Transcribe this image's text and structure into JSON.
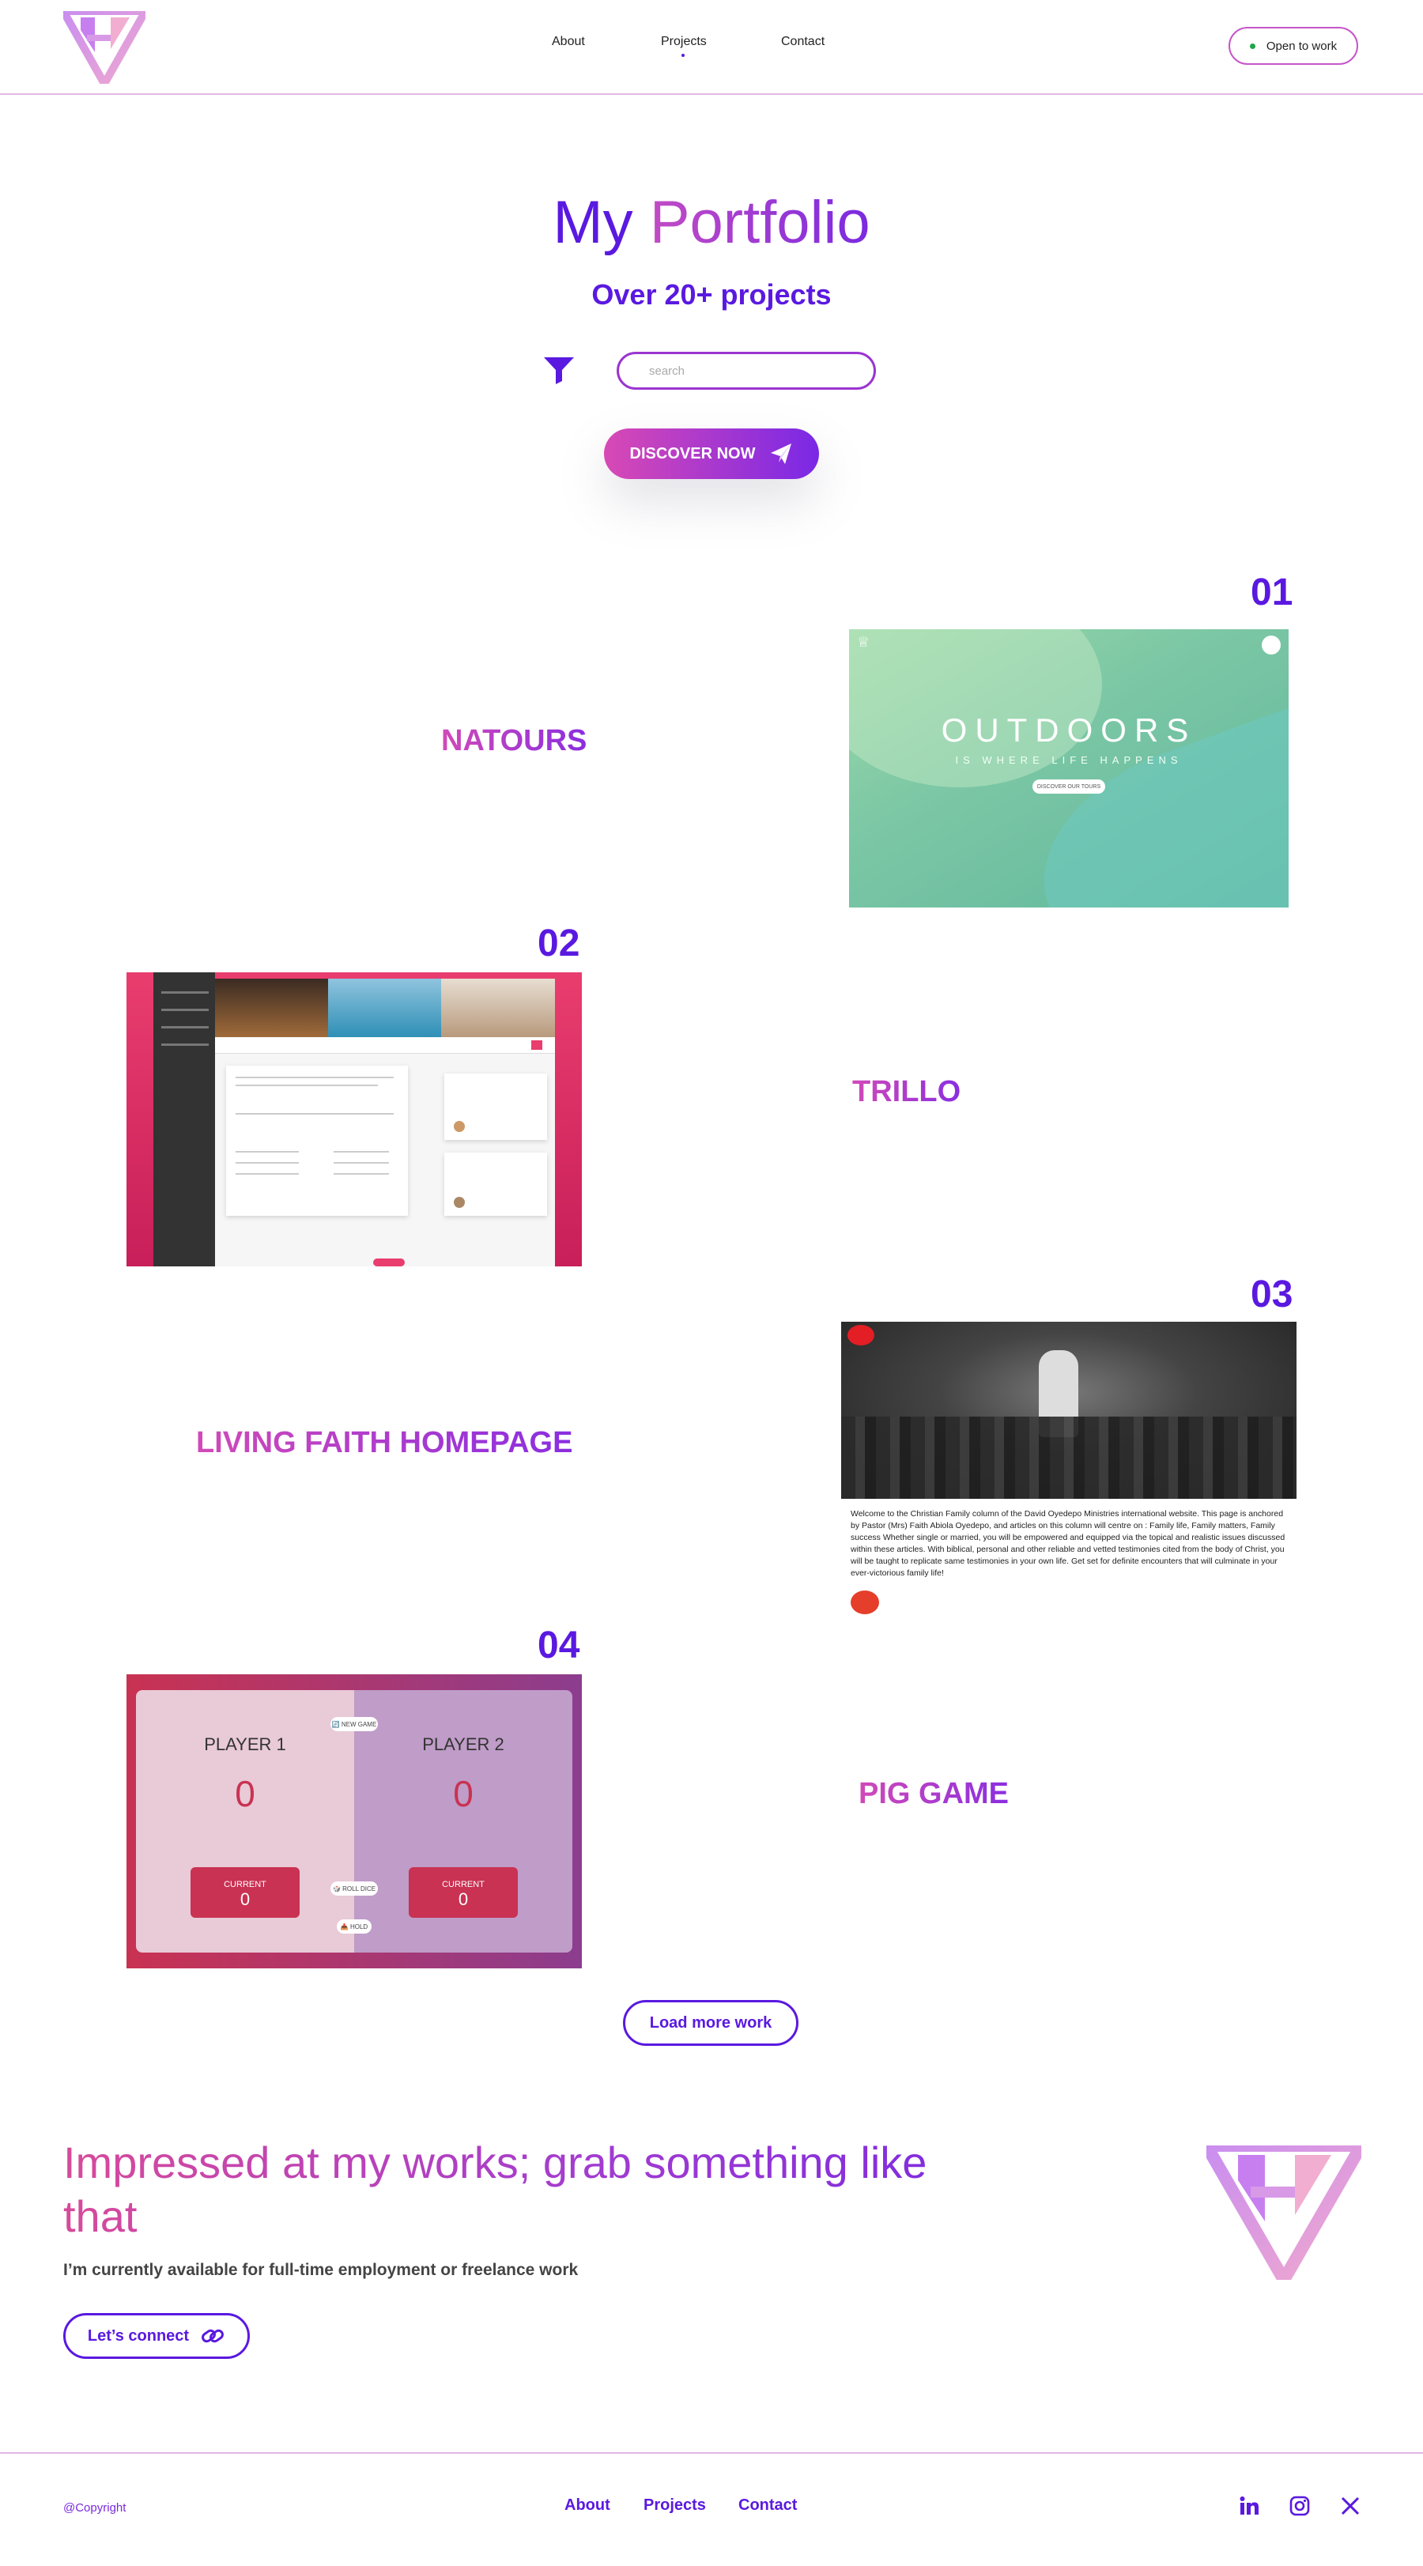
{
  "header": {
    "logo_icon": "hv-monogram-logo",
    "nav": [
      {
        "label": "About"
      },
      {
        "label": "Projects",
        "active": true
      },
      {
        "label": "Contact"
      }
    ],
    "status_button": "Open to work",
    "status_color": "#1fa64a"
  },
  "hero": {
    "title_part1": "My",
    "title_part2": "Portfolio",
    "subtitle": "Over 20+ projects",
    "search_placeholder": "search",
    "filter_icon": "funnel-icon",
    "discover_button": "DISCOVER NOW",
    "discover_icon": "paper-plane-icon"
  },
  "projects": [
    {
      "number": "01",
      "name": "NATOURS"
    },
    {
      "number": "02",
      "name": "TRILLO"
    },
    {
      "number": "03",
      "name": "LIVING FAITH HOMEPAGE"
    },
    {
      "number": "04",
      "name": "PIG GAME"
    }
  ],
  "natours_preview": {
    "headline": "OUTDOORS",
    "tagline": "IS WHERE LIFE HAPPENS",
    "button": "DISCOVER OUR TOURS"
  },
  "faith_preview": {
    "paragraph": "Welcome to the Christian Family column of the David Oyedepo Ministries international website.  This page is anchored by Pastor (Mrs) Faith Abiola Oyedepo, and articles on this column will centre on : Family life, Family matters, Family success Whether single or married, you will be empowered and equipped via the topical and realistic issues discussed within these articles.  With biblical, personal and other reliable and vetted testimonies cited from the body of Christ, you will be taught to replicate same testimonies in your own life. Get set for definite encounters that will culminate in your ever-victorious family life!"
  },
  "pig_preview": {
    "player1": "PLAYER 1",
    "player2": "PLAYER 2",
    "score1": "0",
    "score2": "0",
    "current_label": "CURRENT",
    "current1": "0",
    "current2": "0",
    "new_game": "🔄 NEW GAME",
    "roll_dice": "🎲 ROLL DICE",
    "hold": "📥 HOLD"
  },
  "load_more": "Load more work",
  "cta": {
    "title": "Impressed at my works; grab something like that",
    "subtitle": "I’m currently available for full-time employment or freelance work",
    "button": "Let’s connect",
    "button_icon": "link-icon"
  },
  "footer": {
    "copyright": "@Copyright",
    "links": [
      {
        "label": "About"
      },
      {
        "label": "Projects"
      },
      {
        "label": "Contact"
      }
    ],
    "social": [
      "linkedin-icon",
      "instagram-icon",
      "x-icon"
    ]
  },
  "colors": {
    "primary": "#5a19e0",
    "accent": "#c24bc5",
    "border": "#e2b7e6"
  }
}
